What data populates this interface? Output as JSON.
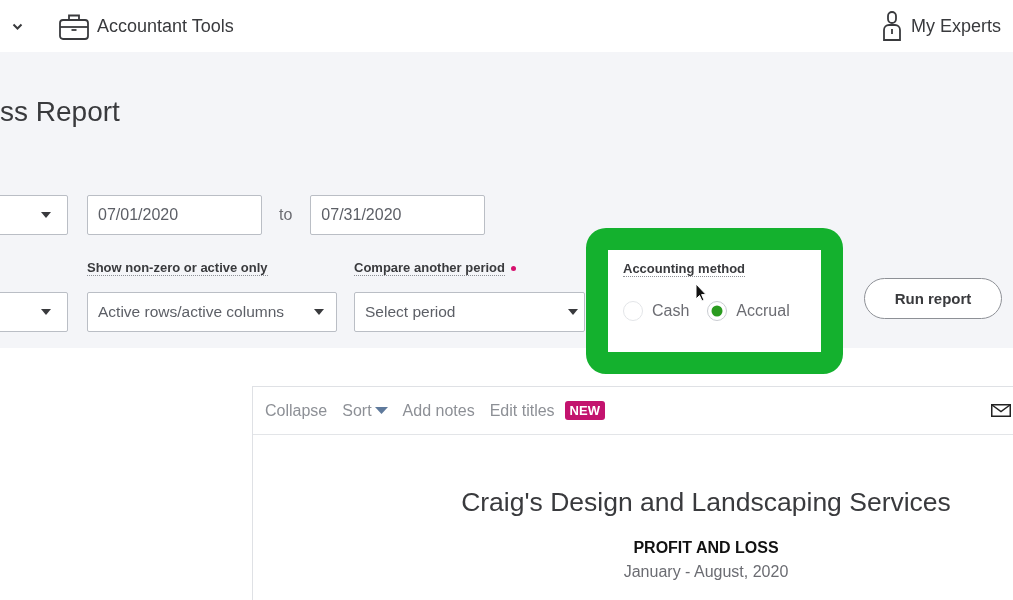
{
  "header": {
    "tools": {
      "label": "Accountant Tools"
    },
    "experts": {
      "label": "My Experts"
    }
  },
  "report_title": "ss Report",
  "date_range": {
    "start": "07/01/2020",
    "separator": "to",
    "end": "07/31/2020"
  },
  "options": [
    {
      "label": "Show non-zero or active only",
      "value": "Active rows/active columns",
      "notification_dot": false
    },
    {
      "label": "Compare another period",
      "placeholder": "Select period",
      "notification_dot": true
    }
  ],
  "accounting_method": {
    "label": "Accounting method",
    "highlighted": true,
    "options": [
      {
        "label": "Cash",
        "selected": false
      },
      {
        "label": "Accrual",
        "selected": true
      }
    ]
  },
  "run_button": {
    "label": "Run report"
  },
  "report": {
    "toolbar": [
      {
        "kind": "link",
        "label": "Collapse"
      },
      {
        "kind": "dropdown",
        "label": "Sort"
      },
      {
        "kind": "link",
        "label": "Add notes"
      },
      {
        "kind": "link",
        "label": "Edit titles",
        "badge": "NEW"
      }
    ],
    "company": "Craig's Design and Landscaping Services",
    "title": "PROFIT AND LOSS",
    "period": "January - August, 2020"
  }
}
